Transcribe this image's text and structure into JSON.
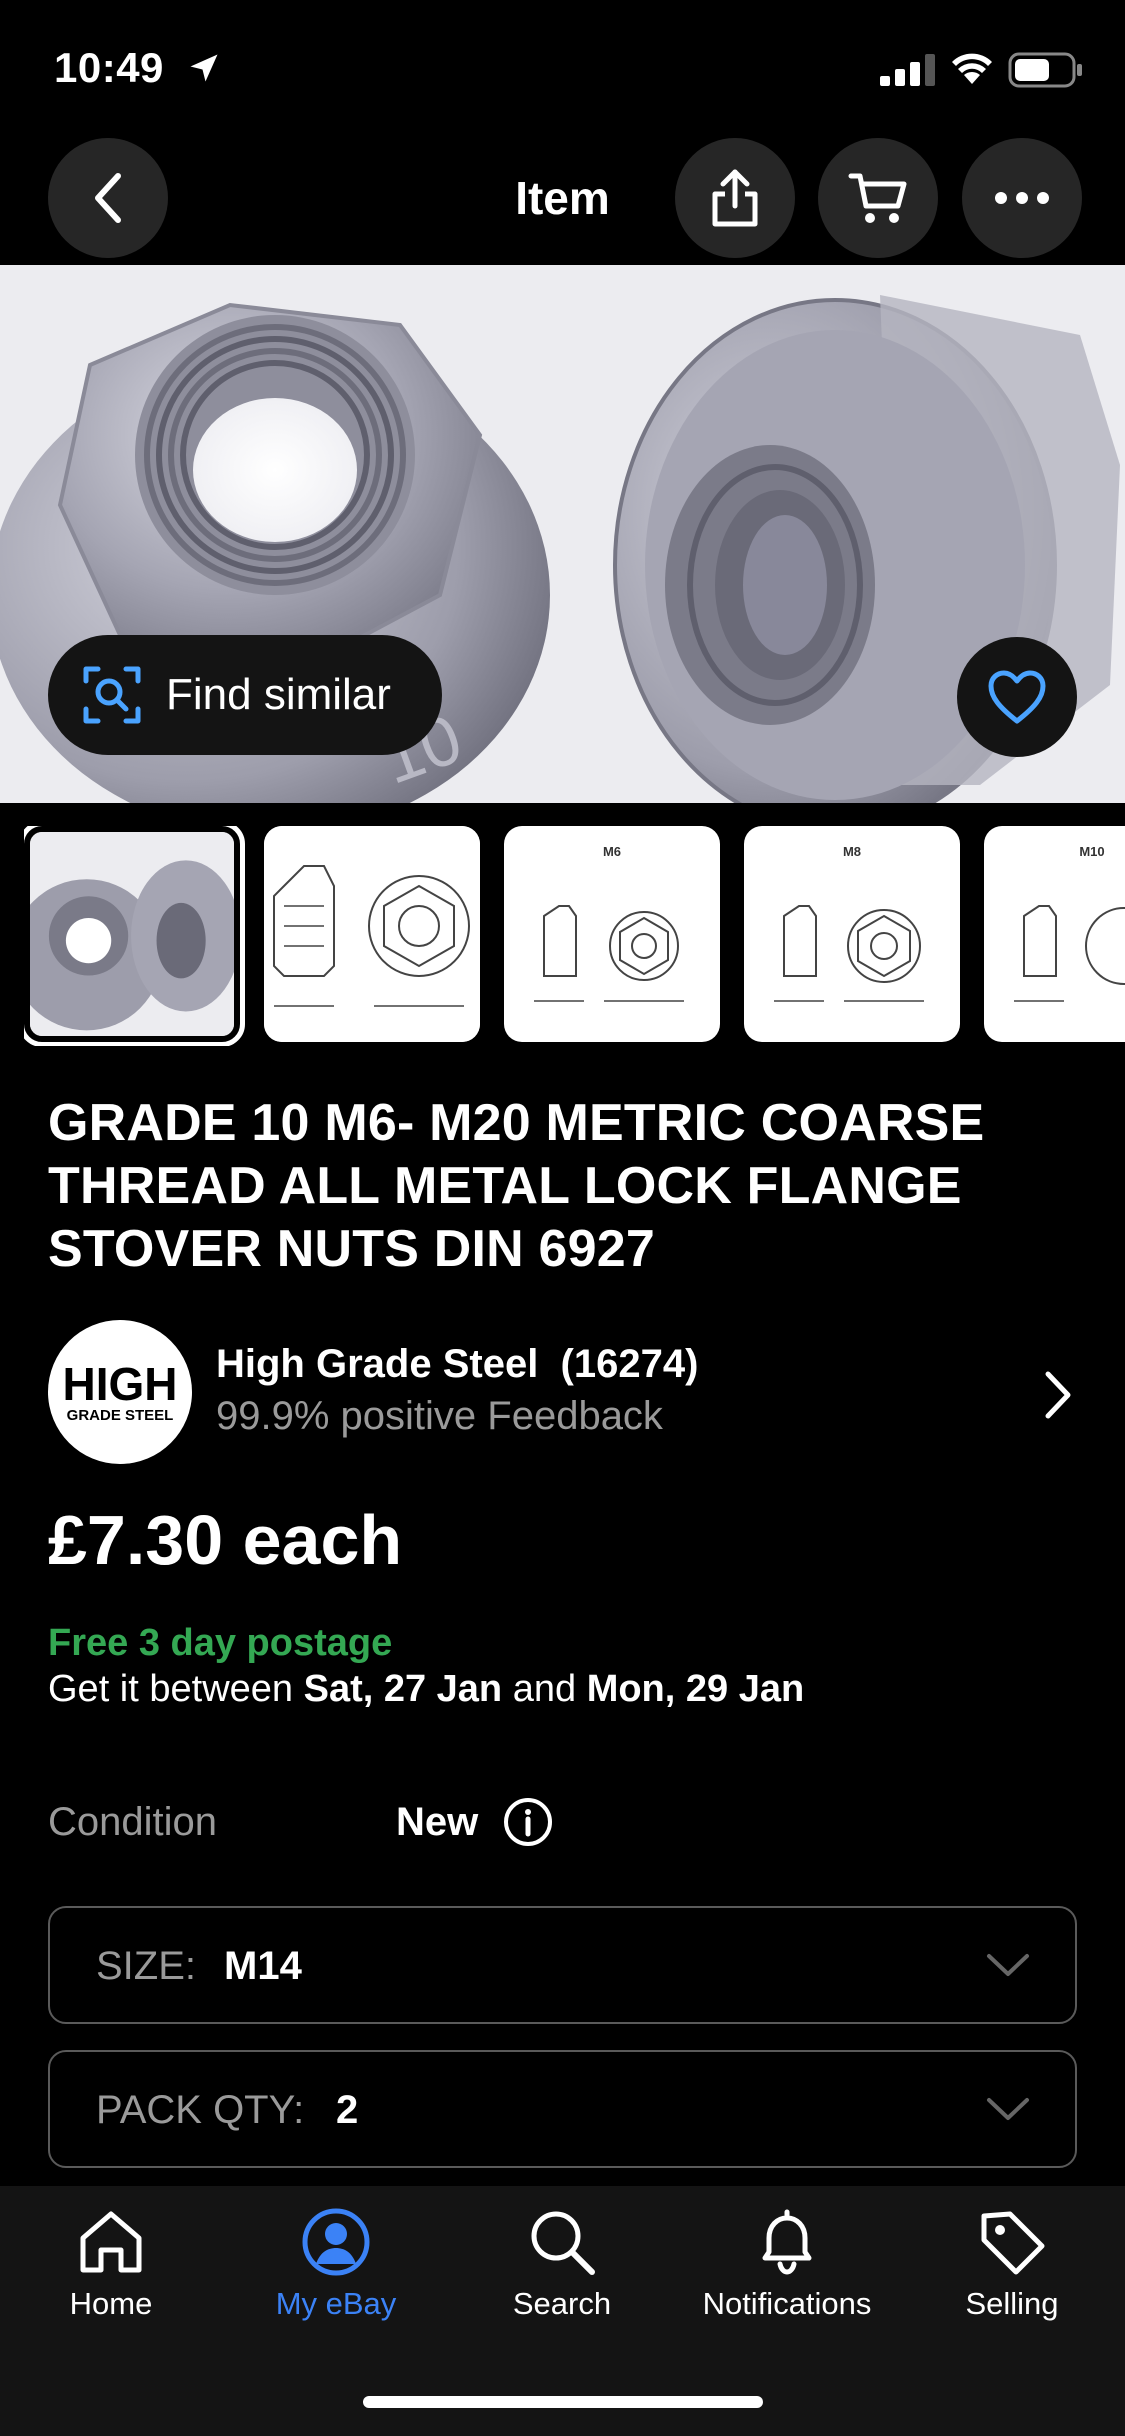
{
  "status_bar": {
    "time": "10:49"
  },
  "nav": {
    "title": "Item"
  },
  "hero": {
    "find_similar_label": "Find similar",
    "nut_marking": "10"
  },
  "thumbnails": [
    {
      "label": ""
    },
    {
      "label": ""
    },
    {
      "label": "M6"
    },
    {
      "label": "M8"
    },
    {
      "label": "M10"
    }
  ],
  "listing": {
    "title": "GRADE 10 M6- M20 METRIC COARSE THREAD ALL METAL LOCK FLANGE STOVER NUTS DIN 6927",
    "price": "£7.30 each",
    "postage": "Free 3 day postage",
    "delivery_prefix": "Get it between ",
    "delivery_start": "Sat, 27 Jan",
    "delivery_mid": " and ",
    "delivery_end": "Mon, 29 Jan",
    "condition_label": "Condition",
    "condition_value": "New"
  },
  "seller": {
    "name": "High Grade Steel",
    "rating_count": "(16274)",
    "feedback": "99.9% positive Feedback",
    "logo_top": "HIGH",
    "logo_bottom": "GRADE STEEL"
  },
  "variations": [
    {
      "label": "SIZE:",
      "value": "M14"
    },
    {
      "label": "PACK QTY:",
      "value": "2"
    }
  ],
  "tab_bar": {
    "tabs": [
      {
        "label": "Home",
        "icon": "home-icon",
        "active": false
      },
      {
        "label": "My eBay",
        "icon": "user-icon",
        "active": true
      },
      {
        "label": "Search",
        "icon": "search-icon",
        "active": false
      },
      {
        "label": "Notifications",
        "icon": "bell-icon",
        "active": false
      },
      {
        "label": "Selling",
        "icon": "tag-icon",
        "active": false
      }
    ],
    "active_color": "#3b82f6"
  },
  "colors": {
    "accent_green": "#34a853",
    "background": "#000000",
    "button_bg": "#262626"
  }
}
